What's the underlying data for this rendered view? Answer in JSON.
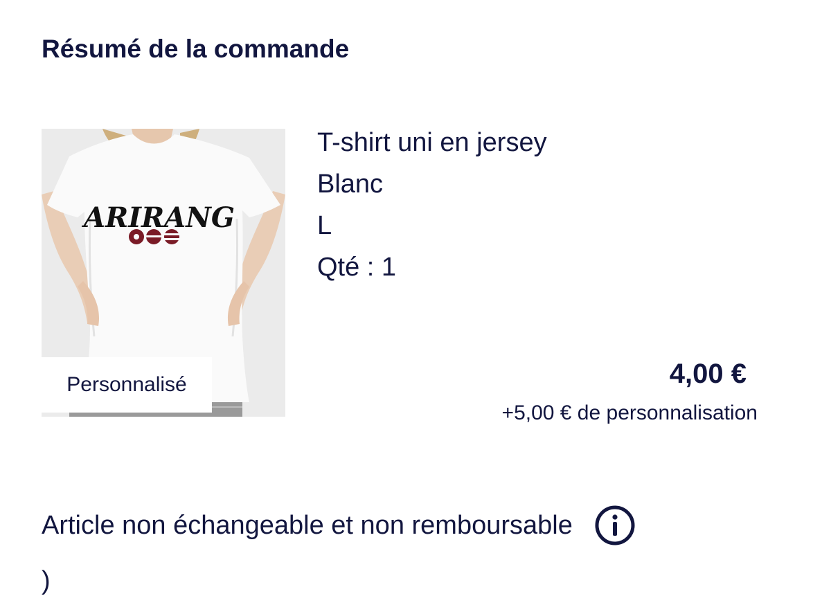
{
  "order_summary": {
    "title": "Résumé de la commande"
  },
  "item": {
    "image": {
      "alt": "T-shirt uni en jersey",
      "print_logo_text": "ARIRANG",
      "icon": "tshirt-photo"
    },
    "badge_label": "Personnalisé",
    "name": "T-shirt uni en jersey",
    "color": "Blanc",
    "size": "L",
    "quantity_label": "Qté : 1",
    "price": "4,00 €",
    "personalisation_fee": "+5,00 € de personnalisation"
  },
  "notice": {
    "text": "Article non échangeable et non remboursable",
    "icon": "info-icon"
  },
  "below_fold": {
    "partial_text": ")"
  },
  "colors": {
    "text_primary": "#12163f",
    "background": "#ffffff",
    "image_background": "#ebebeb",
    "print_dark_red": "#7a1b26"
  }
}
